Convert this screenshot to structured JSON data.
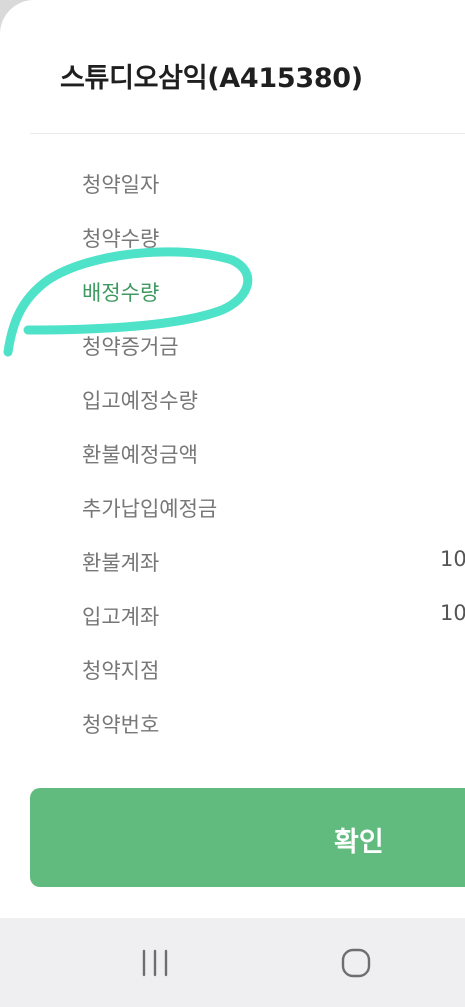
{
  "dialog": {
    "title": "스튜디오삼익(A415380)"
  },
  "rows": [
    {
      "label": "청약일자",
      "value": ""
    },
    {
      "label": "청약수량",
      "value": ""
    },
    {
      "label": "배정수량",
      "value": ""
    },
    {
      "label": "청약증거금",
      "value": ""
    },
    {
      "label": "입고예정수량",
      "value": ""
    },
    {
      "label": "환불예정금액",
      "value": ""
    },
    {
      "label": "추가납입예정금",
      "value": ""
    },
    {
      "label": "환불계좌",
      "value": "10"
    },
    {
      "label": "입고계좌",
      "value": "10"
    },
    {
      "label": "청약지점",
      "value": ""
    },
    {
      "label": "청약번호",
      "value": ""
    }
  ],
  "confirm_button": {
    "label": "확인"
  },
  "colors": {
    "highlight_label": "#3f9a61",
    "confirm_button": "#62bb7e",
    "annotation_stroke": "#3fe0c4"
  },
  "navbar": {
    "icons": [
      "recent-apps-icon",
      "home-icon"
    ]
  }
}
